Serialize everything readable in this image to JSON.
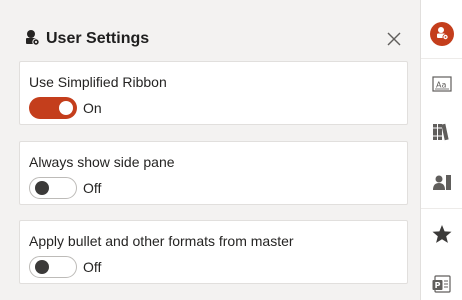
{
  "pane": {
    "title": "User Settings",
    "title_icon": "user-settings-icon",
    "close_icon": "close-icon",
    "settings": [
      {
        "label": "Use Simplified Ribbon",
        "enabled": true,
        "state_label": "On"
      },
      {
        "label": "Always show side pane",
        "enabled": false,
        "state_label": "Off"
      },
      {
        "label": "Apply bullet and other formats from master",
        "enabled": false,
        "state_label": "Off"
      }
    ]
  },
  "rail": {
    "items": [
      {
        "icon": "user-settings-icon",
        "active": true
      },
      {
        "icon": "text-format-icon",
        "active": false
      },
      {
        "icon": "library-icon",
        "active": false
      },
      {
        "icon": "people-icon",
        "active": false
      },
      {
        "icon": "star-icon",
        "active": false
      },
      {
        "icon": "powerpoint-icon",
        "active": false
      }
    ]
  },
  "colors": {
    "accent": "#c43e1c",
    "pane_background": "#f3f2f1",
    "card_background": "#ffffff"
  }
}
